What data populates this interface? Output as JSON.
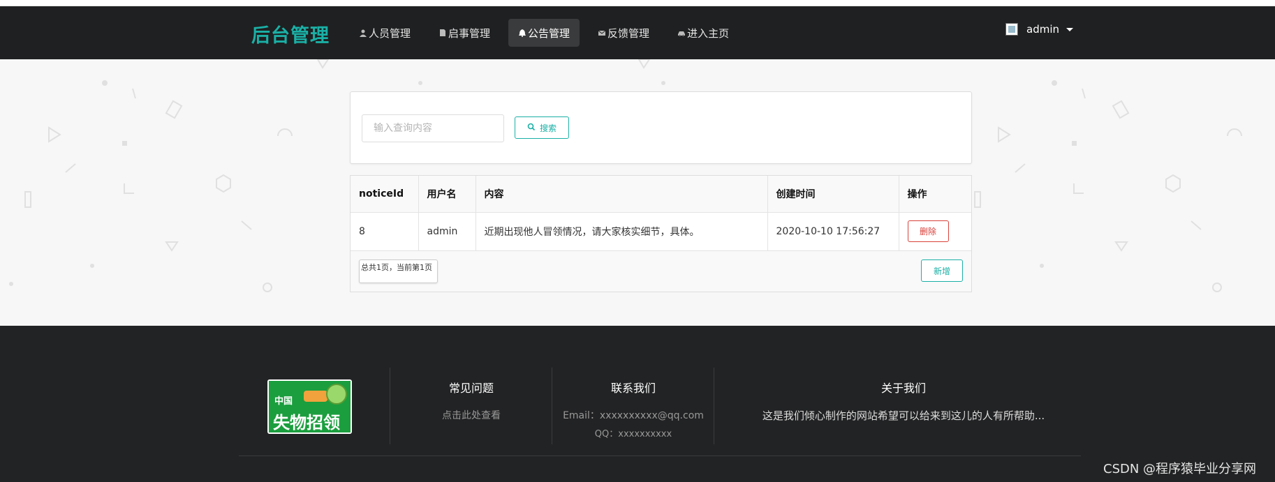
{
  "brand": "后台管理",
  "nav": [
    {
      "label": "人员管理",
      "icon": "user-icon",
      "active": false
    },
    {
      "label": "启事管理",
      "icon": "file-icon",
      "active": false
    },
    {
      "label": "公告管理",
      "icon": "bell-icon",
      "active": true
    },
    {
      "label": "反馈管理",
      "icon": "envelope-icon",
      "active": false
    },
    {
      "label": "进入主页",
      "icon": "car-icon",
      "active": false
    }
  ],
  "user": {
    "name": "admin"
  },
  "search": {
    "placeholder": "输入查询内容",
    "button": "搜索"
  },
  "table": {
    "headers": [
      "noticeId",
      "用户名",
      "内容",
      "创建时间",
      "操作"
    ],
    "rows": [
      {
        "noticeId": "8",
        "username": "admin",
        "content": "近期出现他人冒领情况，请大家核实细节，具体。",
        "created": "2020-10-10 17:56:27",
        "action": "删除"
      }
    ],
    "pager": "总共1页，当前第1页",
    "add": "新增"
  },
  "footer": {
    "logo_top": "中国",
    "logo_main": "失物招领",
    "faq_title": "常见问题",
    "faq_link": "点击此处查看",
    "contact_title": "联系我们",
    "email": "Email：xxxxxxxxxx@qq.com",
    "qq": "QQ：xxxxxxxxxx",
    "about_title": "关于我们",
    "about_text": "这是我们倾心制作的网站希望可以给来到这儿的人有所帮助..."
  },
  "watermark": "CSDN @程序猿毕业分享网",
  "colors": {
    "accent": "#1ab0a6",
    "danger": "#d9403a",
    "nav_bg": "#1f2021",
    "footer_bg": "#222324"
  }
}
